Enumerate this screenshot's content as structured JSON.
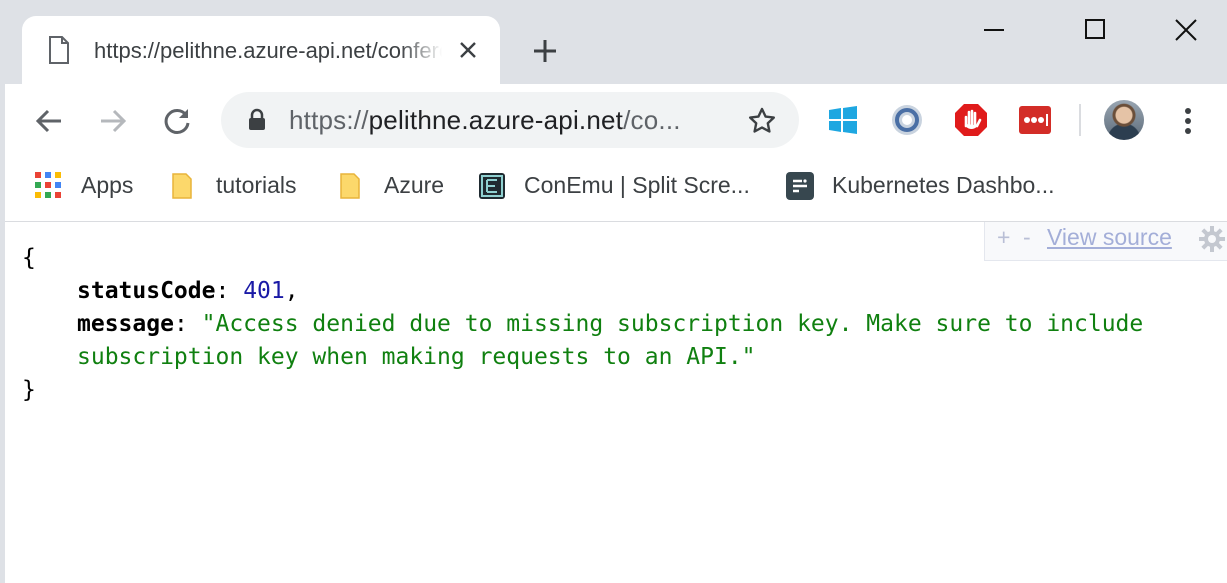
{
  "tab": {
    "title": "https://pelithne.azure-api.net/conference/sessions"
  },
  "omnibox": {
    "url_scheme": "https://",
    "url_host": "pelithne.azure-api.net",
    "url_rest": "/co..."
  },
  "bookmarks": [
    {
      "label": "Apps",
      "icon": "apps-grid-icon"
    },
    {
      "label": "tutorials",
      "icon": "folder-icon"
    },
    {
      "label": "Azure",
      "icon": "folder-icon"
    },
    {
      "label": "ConEmu | Split Scre...",
      "icon": "conemu-icon"
    },
    {
      "label": "Kubernetes Dashbo...",
      "icon": "kubernetes-dashboard-icon"
    }
  ],
  "extensions": [
    "windows-icon",
    "circle-ring-icon",
    "stop-hand-icon",
    "lastpass-icon"
  ],
  "json_viewer": {
    "plus": "+",
    "minus": "-",
    "view_source": "View source"
  },
  "response": {
    "open_brace": "{",
    "close_brace": "}",
    "status_key": "statusCode",
    "status_value": "401",
    "message_key": "message",
    "message_line1": "\"Access denied due to missing subscription key. Make sure to include",
    "message_line2": "subscription key when making requests to an API.\""
  },
  "colors": {
    "tabstrip": "#dee1e6",
    "number": "#1a1aa6",
    "string": "#108010"
  }
}
